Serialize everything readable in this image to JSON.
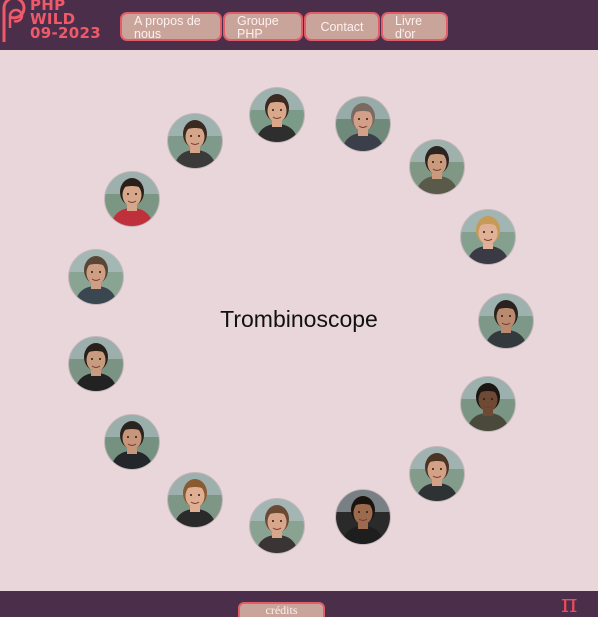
{
  "header": {
    "logo": {
      "line1": "PHP",
      "line2": "WILD",
      "line3": "09-2023",
      "icon": "php-wild-logo-icon"
    },
    "nav": [
      {
        "label": "A propos de nous"
      },
      {
        "label": "Groupe PHP"
      },
      {
        "label": "Contact"
      },
      {
        "label": "Livre d'or"
      }
    ]
  },
  "main": {
    "title": "Trombinoscope",
    "members": [
      {
        "hair": "#3a2a22",
        "skin": "#d9a88a",
        "shirt": "#2e2e2e",
        "bg": "#7c9a88"
      },
      {
        "hair": "#7a6a60",
        "skin": "#d2a089",
        "shirt": "#3b3f4a",
        "bg": "#6f8a7a"
      },
      {
        "hair": "#2c2420",
        "skin": "#c99a7c",
        "shirt": "#5a5a4a",
        "bg": "#7f9784"
      },
      {
        "hair": "#c79a55",
        "skin": "#e0b196",
        "shirt": "#3a3a44",
        "bg": "#86a090"
      },
      {
        "hair": "#2a221e",
        "skin": "#b98a6d",
        "shirt": "#323a3e",
        "bg": "#7d9888"
      },
      {
        "hair": "#1c1612",
        "skin": "#6e4a34",
        "shirt": "#4a4a3c",
        "bg": "#7a9583"
      },
      {
        "hair": "#4a3424",
        "skin": "#d3a286",
        "shirt": "#2f3234",
        "bg": "#839b8a"
      },
      {
        "hair": "#1a1410",
        "skin": "#9c6b4e",
        "shirt": "#1e1e1e",
        "bg": "#2a2a2a"
      },
      {
        "hair": "#6a4a34",
        "skin": "#d7a68b",
        "shirt": "#3a3434",
        "bg": "#8aa291"
      },
      {
        "hair": "#8a5a30",
        "skin": "#dfae93",
        "shirt": "#2a2a2a",
        "bg": "#7e9685"
      },
      {
        "hair": "#2a2420",
        "skin": "#c6957a",
        "shirt": "#23262a",
        "bg": "#75917f"
      },
      {
        "hair": "#2a201a",
        "skin": "#c89a7e",
        "shirt": "#222222",
        "bg": "#7a9383"
      },
      {
        "hair": "#5a4636",
        "skin": "#cf9f83",
        "shirt": "#3a4650",
        "bg": "#8aa494"
      },
      {
        "hair": "#2a201a",
        "skin": "#d7a78c",
        "shirt": "#c0303a",
        "bg": "#7c9684"
      },
      {
        "hair": "#3a2a22",
        "skin": "#d5a489",
        "shirt": "#3a3a3a",
        "bg": "#7f998a"
      }
    ]
  },
  "footer": {
    "credits_label": "crédits",
    "pi_symbol": "π"
  }
}
